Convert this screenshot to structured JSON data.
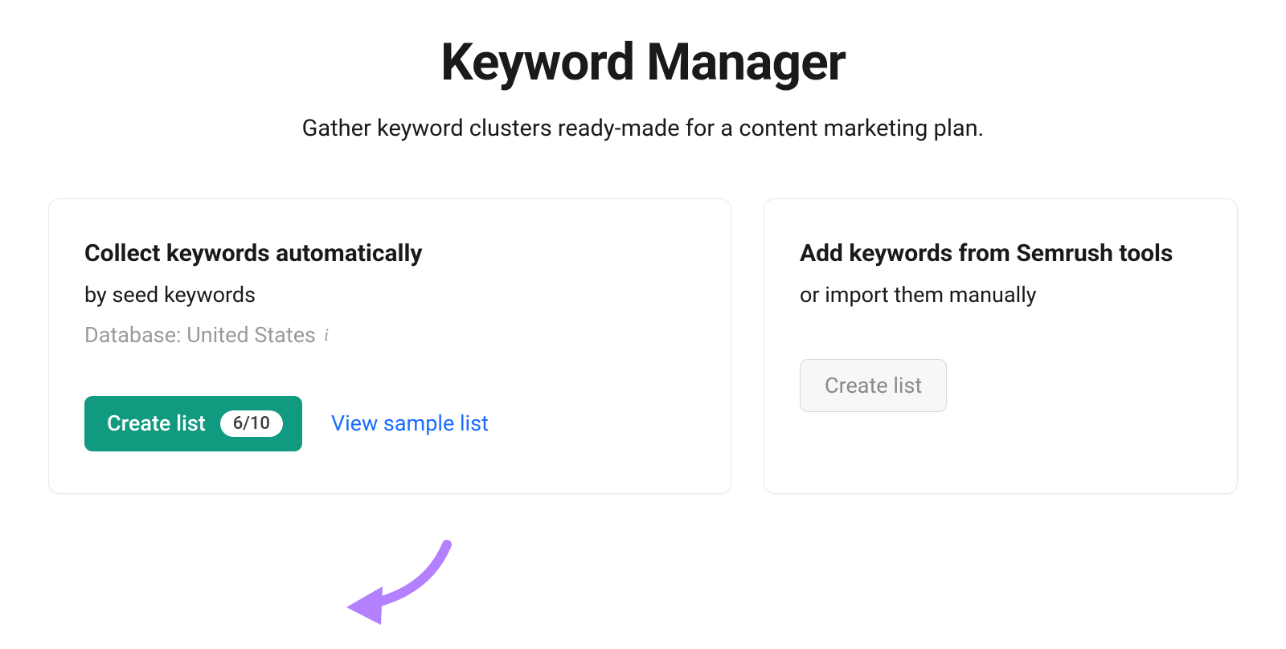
{
  "header": {
    "title": "Keyword Manager",
    "subtitle": "Gather keyword clusters ready-made for a content marketing plan."
  },
  "cards": {
    "automatic": {
      "title": "Collect keywords automatically",
      "subtext": "by seed keywords",
      "database_label": "Database: United States",
      "create_button_label": "Create list",
      "create_button_badge": "6/10",
      "view_sample_link": "View sample list"
    },
    "manual": {
      "title": "Add keywords from Semrush tools",
      "subtext": "or import them manually",
      "create_button_label": "Create list"
    }
  },
  "colors": {
    "primary_button": "#109a7f",
    "link": "#1a6dff",
    "annotation": "#b380ff"
  }
}
